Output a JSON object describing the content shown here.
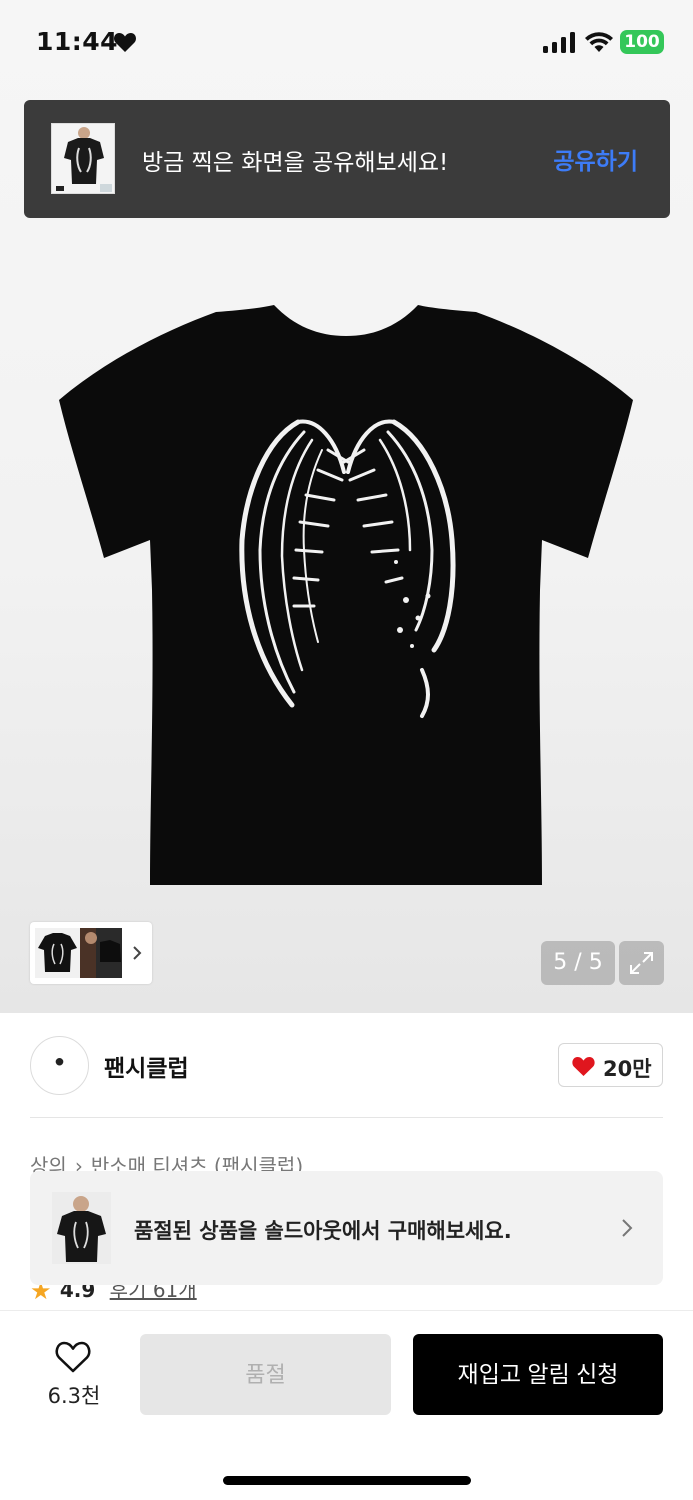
{
  "status_bar": {
    "time": "11:44",
    "battery": "100",
    "heart_icon": "heart-icon",
    "signal_icon": "cellular-signal-icon",
    "wifi_icon": "wifi-icon"
  },
  "share_banner": {
    "message": "방금 찍은 화면을 공유해보세요!",
    "action_label": "공유하기",
    "action_color": "#3d7cf7"
  },
  "gallery": {
    "counter": "5 / 5",
    "thumbnail_chevron_icon": "chevron-right-icon",
    "expand_icon": "expand-icon"
  },
  "brand": {
    "logo_text": "ꔷ",
    "name": "팬시클럽",
    "likes": "20만",
    "like_color": "#e0161e"
  },
  "breadcrumb": {
    "category": "상의",
    "subcategory": "반소매 티셔츠 (팬시클럽)"
  },
  "rating": {
    "score": "4.9",
    "reviews_label": "후기 61개"
  },
  "soldout_toast": {
    "message": "품절된 상품을 솔드아웃에서 구매해보세요."
  },
  "action_bar": {
    "wish_count": "6.3천",
    "soldout_label": "품절",
    "restock_label": "재입고 알림 신청"
  }
}
